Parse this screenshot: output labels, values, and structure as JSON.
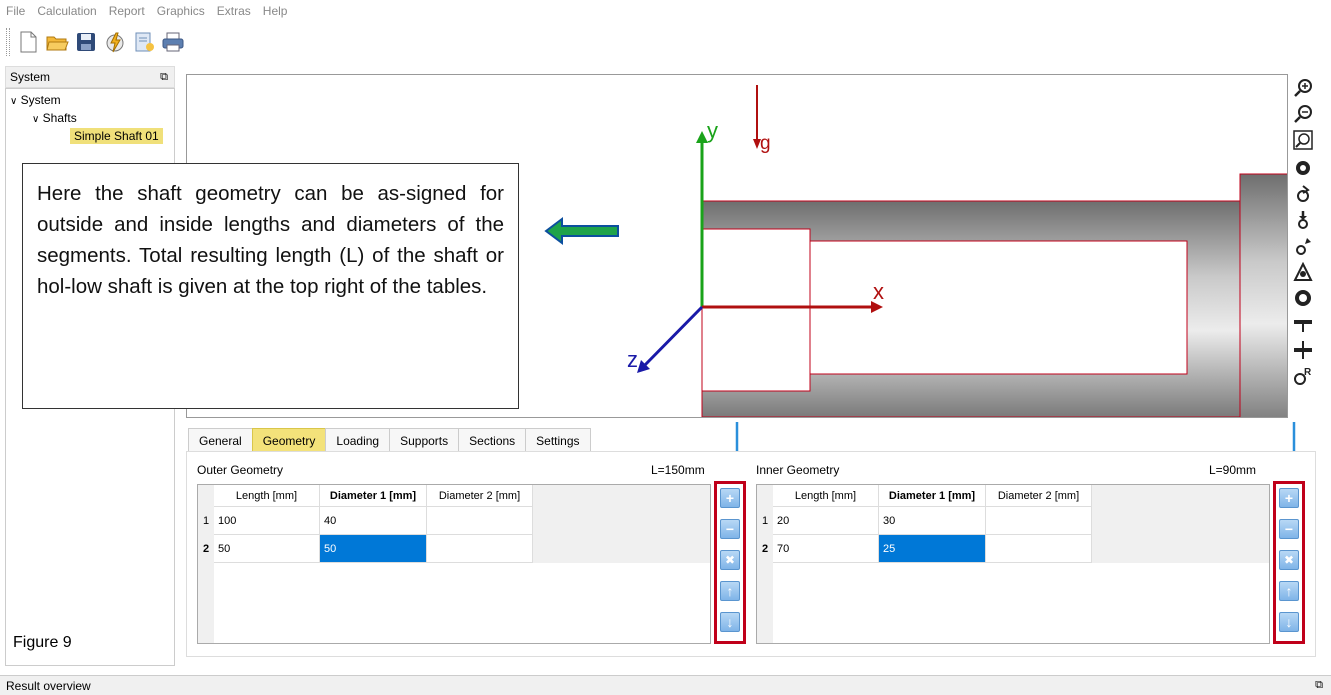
{
  "menu": [
    "File",
    "Calculation",
    "Report",
    "Graphics",
    "Extras",
    "Help"
  ],
  "toolbar": {
    "icons": [
      "new-file-icon",
      "open-folder-icon",
      "save-icon",
      "calculate-icon",
      "report-icon",
      "print-icon"
    ]
  },
  "system_panel": {
    "title": "System",
    "tree": {
      "root": "System",
      "child": "Shafts",
      "leaf": "Simple Shaft 01"
    }
  },
  "view": {
    "axis_y": "y",
    "axis_x": "x",
    "axis_z": "z",
    "gravity": "g"
  },
  "callout": {
    "text": "Here the shaft geometry can be as-signed for outside and inside lengths and diameters of the segments. Total resulting length (L) of the shaft or hol-low shaft is given at the top right of the tables."
  },
  "tabs": [
    {
      "label": "General",
      "active": false
    },
    {
      "label": "Geometry",
      "active": true
    },
    {
      "label": "Loading",
      "active": false
    },
    {
      "label": "Supports",
      "active": false
    },
    {
      "label": "Sections",
      "active": false
    },
    {
      "label": "Settings",
      "active": false
    }
  ],
  "outer": {
    "title": "Outer Geometry",
    "total": "L=150mm",
    "headers": [
      "Length [mm]",
      "Diameter 1 [mm]",
      "Diameter 2 [mm]"
    ],
    "rows": [
      {
        "num": "1",
        "length": "100",
        "d1": "40",
        "d2": ""
      },
      {
        "num": "2",
        "length": "50",
        "d1": "50",
        "d2": ""
      }
    ]
  },
  "inner": {
    "title": "Inner Geometry",
    "total": "L=90mm",
    "headers": [
      "Length [mm]",
      "Diameter 1 [mm]",
      "Diameter 2 [mm]"
    ],
    "rows": [
      {
        "num": "1",
        "length": "20",
        "d1": "30",
        "d2": ""
      },
      {
        "num": "2",
        "length": "70",
        "d1": "25",
        "d2": ""
      }
    ]
  },
  "row_buttons": [
    "add-row-icon",
    "remove-row-icon",
    "delete-icon",
    "move-up-icon",
    "move-down-icon"
  ],
  "figure_label": "Figure 9",
  "statusbar": {
    "label": "Result overview"
  }
}
